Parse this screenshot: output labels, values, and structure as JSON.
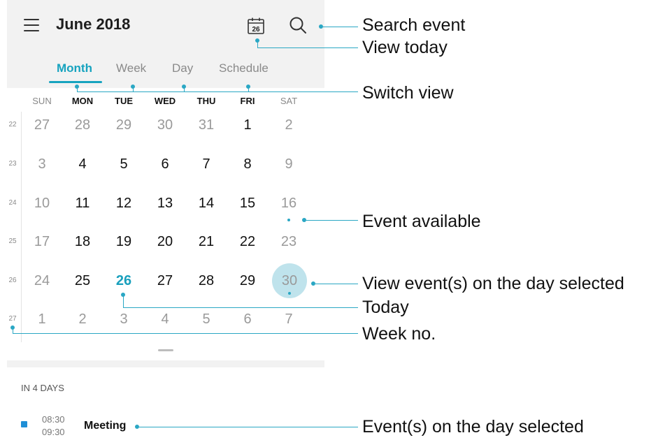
{
  "header": {
    "title": "June 2018",
    "calendar_icon_day": "26"
  },
  "tabs": [
    {
      "label": "Month",
      "active": true
    },
    {
      "label": "Week",
      "active": false
    },
    {
      "label": "Day",
      "active": false
    },
    {
      "label": "Schedule",
      "active": false
    }
  ],
  "weekdays": [
    "SUN",
    "MON",
    "TUE",
    "WED",
    "THU",
    "FRI",
    "SAT"
  ],
  "weeks": [
    {
      "number": "22",
      "days": [
        "27",
        "28",
        "29",
        "30",
        "31",
        "1",
        "2"
      ]
    },
    {
      "number": "23",
      "days": [
        "3",
        "4",
        "5",
        "6",
        "7",
        "8",
        "9"
      ]
    },
    {
      "number": "24",
      "days": [
        "10",
        "11",
        "12",
        "13",
        "14",
        "15",
        "16"
      ]
    },
    {
      "number": "25",
      "days": [
        "17",
        "18",
        "19",
        "20",
        "21",
        "22",
        "23"
      ]
    },
    {
      "number": "26",
      "days": [
        "24",
        "25",
        "26",
        "27",
        "28",
        "29",
        "30"
      ]
    },
    {
      "number": "27",
      "days": [
        "1",
        "2",
        "3",
        "4",
        "5",
        "6",
        "7"
      ]
    }
  ],
  "today": "26",
  "selected": "30",
  "upcoming": {
    "heading": "IN 4 DAYS",
    "event": {
      "start": "08:30",
      "end": "09:30",
      "title": "Meeting"
    }
  },
  "annotations": {
    "search_event": "Search event",
    "view_today": "View today",
    "switch_view": "Switch view",
    "event_available": "Event available",
    "view_events_selected": "View event(s) on the day selected",
    "today": "Today",
    "week_no": "Week no.",
    "events_day_selected": "Event(s) on the day selected"
  },
  "colors": {
    "accent": "#17a3bf",
    "selected_fill": "#bfe3ec",
    "event_square": "#1f8fd6"
  }
}
